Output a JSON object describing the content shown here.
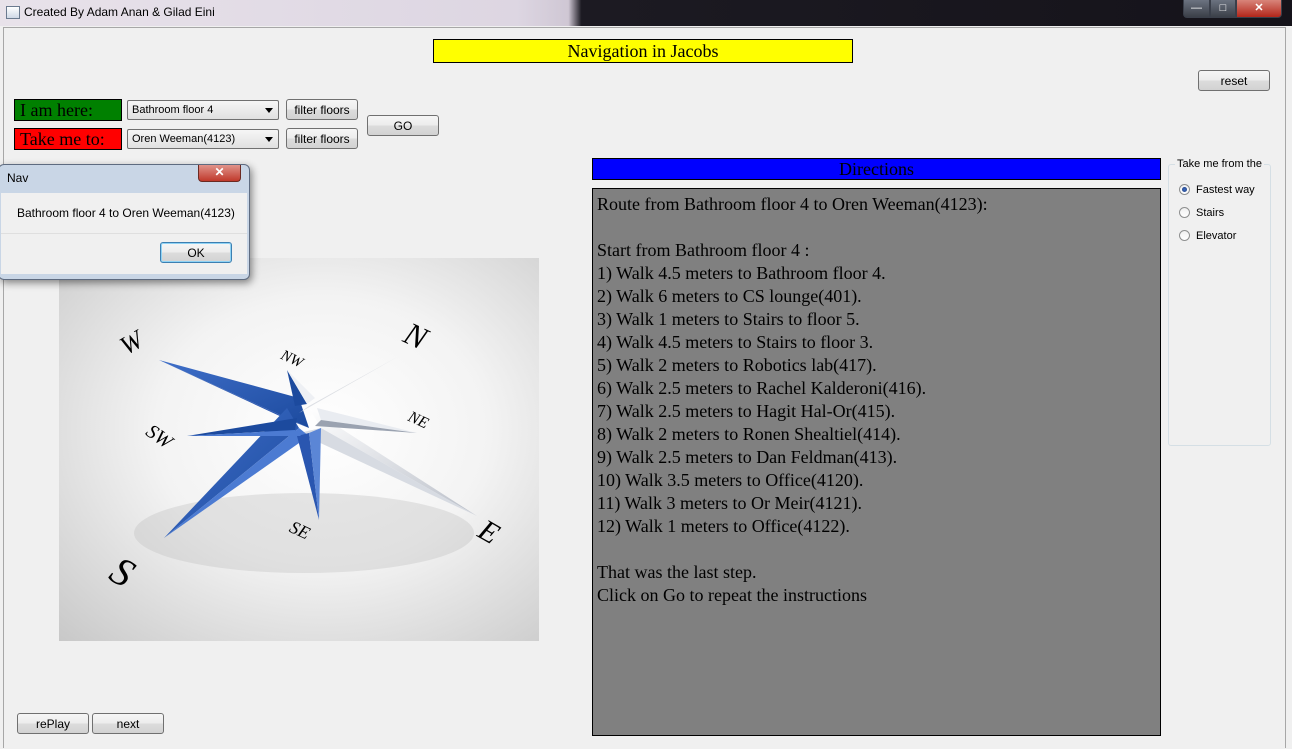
{
  "window": {
    "title": "Created By Adam Anan & Gilad Eini",
    "min_glyph": "—",
    "max_glyph": "□",
    "close_glyph": "✕"
  },
  "header": {
    "title": "Navigation in Jacobs"
  },
  "controls": {
    "reset_label": "reset",
    "from_label": "I am here:",
    "from_value": "Bathroom floor 4",
    "to_label": "Take me to:",
    "to_value": "Oren Weeman(4123)",
    "filter_label": "filter floors",
    "go_label": "GO"
  },
  "route_options": {
    "title": "Take me from the",
    "options": [
      {
        "label": "Fastest way",
        "selected": true
      },
      {
        "label": "Stairs",
        "selected": false
      },
      {
        "label": "Elevator",
        "selected": false
      }
    ]
  },
  "directions": {
    "header": "Directions",
    "lines": [
      "Route from Bathroom floor 4 to Oren Weeman(4123):",
      "",
      "Start from Bathroom floor 4 :",
      "1) Walk 4.5 meters to Bathroom floor 4.",
      "2) Walk 6 meters to CS lounge(401).",
      "3) Walk 1 meters to Stairs to floor 5.",
      "4) Walk 4.5 meters to Stairs to floor 3.",
      "5) Walk 2 meters to Robotics lab(417).",
      "6) Walk 2.5 meters to Rachel Kalderoni(416).",
      "7) Walk 2.5 meters to Hagit Hal-Or(415).",
      "8) Walk 2 meters to Ronen Shealtiel(414).",
      "9) Walk 2.5 meters to Dan Feldman(413).",
      "10) Walk 3.5 meters to Office(4120).",
      "11) Walk 3 meters to Or Meir(4121).",
      "12) Walk 1 meters to Office(4122).",
      "",
      "That was the last step.",
      "Click on Go to repeat the instructions"
    ]
  },
  "compass": {
    "labels": {
      "n": "N",
      "s": "S",
      "e": "E",
      "w": "W",
      "ne": "NE",
      "nw": "NW",
      "se": "SE",
      "sw": "SW"
    }
  },
  "playback": {
    "replay_label": "rePlay",
    "next_label": "next"
  },
  "dialog": {
    "title": "Nav",
    "message": "Bathroom floor 4 to Oren Weeman(4123)",
    "ok_label": "OK",
    "close_glyph": "✕"
  },
  "colors": {
    "banner": "#ffff00",
    "from_tag": "#008000",
    "to_tag": "#ff0000",
    "directions_header": "#0000ff",
    "directions_body": "#808080"
  }
}
